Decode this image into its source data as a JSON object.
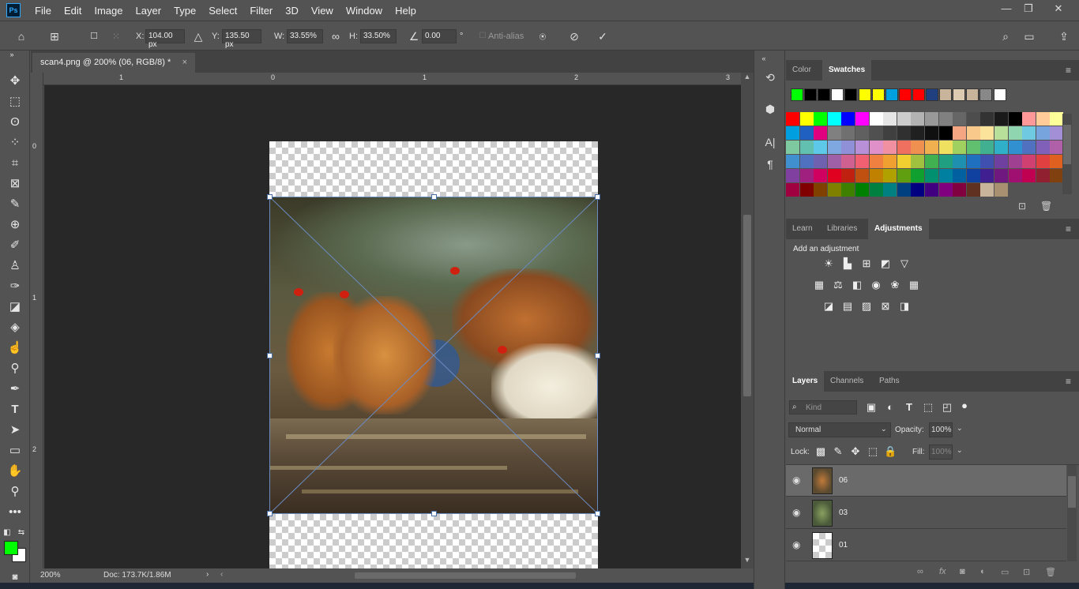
{
  "app": {
    "logo": "Ps"
  },
  "menu": [
    "File",
    "Edit",
    "Image",
    "Layer",
    "Type",
    "Select",
    "Filter",
    "3D",
    "View",
    "Window",
    "Help"
  ],
  "window_controls": {
    "minimize": "—",
    "restore": "❐",
    "close": "✕"
  },
  "options": {
    "x_label": "X:",
    "x_value": "104.00 px",
    "y_label": "Y:",
    "y_value": "135.50 px",
    "w_label": "W:",
    "w_value": "33.55%",
    "h_label": "H:",
    "h_value": "33.50%",
    "angle_value": "0.00",
    "angle_unit": "°",
    "antialias_label": "Anti-alias"
  },
  "document": {
    "tab_title": "scan4.png @ 200% (06, RGB/8) *",
    "tab_close": "×",
    "ruler_h": [
      "1",
      "0",
      "1",
      "2",
      "3"
    ],
    "ruler_v": [
      "0",
      "1",
      "2"
    ],
    "zoom": "200%",
    "doc_info": "Doc: 173.7K/1.86M"
  },
  "color_panel": {
    "tabs": [
      "Color",
      "Swatches"
    ],
    "active_tab": "Swatches",
    "recent_swatches": [
      "#00ff00",
      "#000000",
      "#000000",
      "#ffffff",
      "#000000",
      "#ffff00",
      "#ffff00",
      "#00a0e0",
      "#ff0000",
      "#ff0000",
      "#1f3f7f",
      "#c8b49a",
      "#dccbb0",
      "#c8b49a",
      "#888888",
      "#ffffff"
    ],
    "swatch_rows": [
      [
        "#ff0000",
        "#ffff00",
        "#00ff00",
        "#00ffff",
        "#0000ff",
        "#ff00ff",
        "#ffffff",
        "#e6e6e6",
        "#cccccc",
        "#b3b3b3",
        "#999999",
        "#808080",
        "#666666",
        "#4d4d4d",
        "#333333",
        "#1a1a1a",
        "#000000",
        "#ff9999",
        "#ffcc99",
        "#ffff99",
        "#ccff99",
        "#99ffcc",
        "#99ccff",
        "#cc99ff"
      ],
      [
        "#00a0e0",
        "#2060c0",
        "#e0007f",
        "#808080",
        "#707070",
        "#606060",
        "#505050",
        "#404040",
        "#303030",
        "#202020",
        "#101010",
        "#000000",
        "#f4a582",
        "#f9c98c",
        "#fbe39b",
        "#b8e09a",
        "#8fd6b0",
        "#6fc9e0",
        "#77a4dd",
        "#a38fd6",
        "#d88fc6",
        "#f28c9a",
        "#f7a86b",
        "#ffd86b"
      ],
      [
        "#7fc9a0",
        "#62c0b0",
        "#5ec8e8",
        "#7fa8e0",
        "#9090d8",
        "#b890d8",
        "#e090c8",
        "#f090a0",
        "#f07060",
        "#f09050",
        "#f0b050",
        "#f0e060",
        "#a0d060",
        "#60c070",
        "#40b090",
        "#30b0c8",
        "#3090d0",
        "#5070c0",
        "#8060b8",
        "#b060a8",
        "#e06080",
        "#f06060",
        "#f08040",
        "#f0c040"
      ],
      [
        "#4090d0",
        "#5070c0",
        "#7060b0",
        "#a060a8",
        "#d06090",
        "#f06070",
        "#f08040",
        "#f0a030",
        "#f0d030",
        "#a0c040",
        "#40b050",
        "#20a080",
        "#2090b0",
        "#2070c0",
        "#4050b0",
        "#7040a0",
        "#a04090",
        "#d04070",
        "#e04040",
        "#e06020",
        "#e09010",
        "#d0c010",
        "#80b020",
        "#20a040"
      ],
      [
        "#8040a0",
        "#a02080",
        "#d00060",
        "#e00020",
        "#c02010",
        "#c05010",
        "#c08000",
        "#b0a000",
        "#60a010",
        "#10a030",
        "#009070",
        "#0080a0",
        "#0060a0",
        "#1040a0",
        "#402090",
        "#701880",
        "#a01070",
        "#c00050",
        "#902030",
        "#804010",
        "#806010",
        "#807000",
        "#506010",
        "#106020"
      ],
      [
        "#a00040",
        "#800000",
        "#804000",
        "#808000",
        "#408000",
        "#008000",
        "#008040",
        "#008080",
        "#004080",
        "#000080",
        "#400080",
        "#800080",
        "#800040",
        "#603020",
        "#c8b49a",
        "#a89070"
      ]
    ],
    "new_swatch_icon": "new-swatch-icon",
    "delete_icon": "trash-icon"
  },
  "adjust_panel": {
    "tabs": [
      "Learn",
      "Libraries",
      "Adjustments"
    ],
    "active_tab": "Adjustments",
    "heading": "Add an adjustment"
  },
  "layers_panel": {
    "tabs": [
      "Layers",
      "Channels",
      "Paths"
    ],
    "active_tab": "Layers",
    "filter_placeholder": "Kind",
    "blend_mode": "Normal",
    "opacity_label": "Opacity:",
    "opacity_value": "100%",
    "lock_label": "Lock:",
    "fill_label": "Fill:",
    "fill_value": "100%",
    "layers": [
      {
        "name": "06",
        "selected": true
      },
      {
        "name": "03",
        "selected": false
      },
      {
        "name": "01",
        "selected": false
      }
    ]
  },
  "colors": {
    "foreground": "#00ff00",
    "background": "#ffffff",
    "accent": "#31a8ff"
  }
}
